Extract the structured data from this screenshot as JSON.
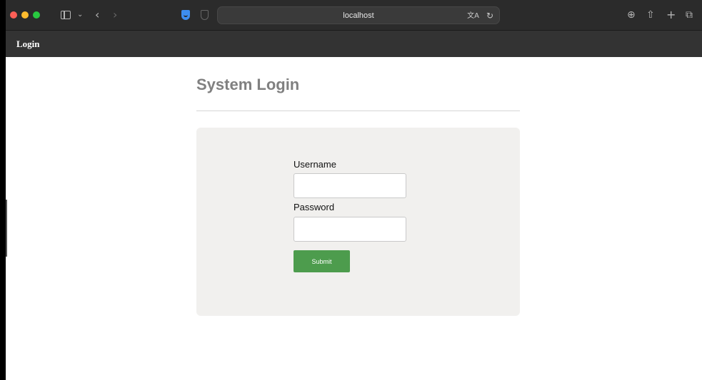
{
  "browser": {
    "address": "localhost",
    "icons": {
      "back": "chevron-left-icon",
      "forward": "chevron-right-icon",
      "sidebar": "sidebar-icon",
      "translate": "translate-icon",
      "reload": "reload-icon",
      "download": "download-icon",
      "share": "share-icon",
      "new_tab": "plus-icon",
      "tabs": "tab-overview-icon"
    },
    "colors": {
      "close": "#fe5f57",
      "minimize": "#febc2e",
      "maximize": "#28c840",
      "privacy_shield": "#3d8ef0"
    }
  },
  "navbar": {
    "brand": "Login"
  },
  "main": {
    "title": "System Login",
    "form": {
      "username_label": "Username",
      "username_value": "",
      "password_label": "Password",
      "password_value": "",
      "submit_label": "Submit"
    }
  },
  "colors": {
    "submit_button": "#4d9c4d",
    "card_background": "#f1f0ee",
    "navbar": "#333333"
  }
}
